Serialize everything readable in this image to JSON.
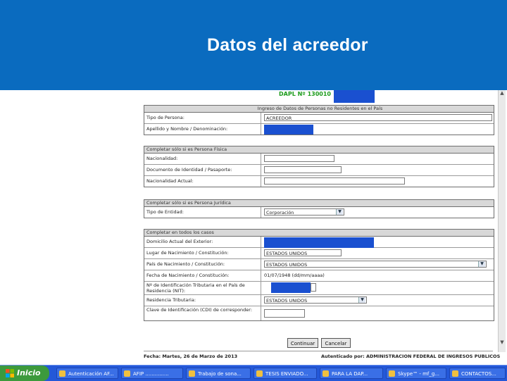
{
  "slide": {
    "title": "Datos del acreedor"
  },
  "browser": {
    "dapl_label": "DAPL Nº 130010",
    "residentes": {
      "header": "Ingreso de Datos de Personas no Residentes en el País",
      "tipo_persona_label": "Tipo de Persona:",
      "tipo_persona_value": "ACREEDOR",
      "apellido_label": "Apellido y Nombre / Denominación:"
    },
    "fisica": {
      "header": "Completar sólo si es Persona Física",
      "nacionalidad_label": "Nacionalidad:",
      "documento_label": "Documento de Identidad / Pasaporte:",
      "nacionalidad_actual_label": "Nacionalidad Actual:"
    },
    "juridica": {
      "header": "Completar sólo si es Persona Jurídica",
      "tipo_entidad_label": "Tipo de Entidad:",
      "tipo_entidad_value": "Corporación"
    },
    "todos": {
      "header": "Completar en todos los casos",
      "domicilio_label": "Domicilio Actual del Exterior:",
      "lugar_nac_label": "Lugar de Nacimiento / Constitución:",
      "lugar_nac_value": "ESTADOS UNIDOS",
      "pais_nac_label": "País de Nacimiento / Constitución:",
      "pais_nac_value": "ESTADOS UNIDOS",
      "fecha_nac_label": "Fecha de Nacimiento / Constitución:",
      "fecha_nac_value": "01/07/1948 (dd/mm/aaaa)",
      "nit_label": "Nº de Identificación Tributaria en el País de Residencia (NIT):",
      "residencia_label": "Residencia Tributaria:",
      "residencia_value": "ESTADOS UNIDOS",
      "clave_label": "Clave de Identificación (CDI) de corresponder:"
    },
    "buttons": {
      "continuar": "Continuar",
      "cancelar": "Cancelar"
    },
    "footer": {
      "fecha": "Fecha: Martes, 26 de Marzo de 2013",
      "autenticado": "Autenticado por: ADMINISTRACION FEDERAL DE INGRESOS PUBLICOS"
    }
  },
  "taskbar": {
    "start_label": "Inicio",
    "tasks": [
      "Autenticación AF...",
      "AFIP ...............",
      "Trabajo de sona...",
      "TESIS ENVIADO...",
      "PARA LA DAP...",
      "Skype™ - mf_g...",
      "CONTACTOS..."
    ]
  }
}
